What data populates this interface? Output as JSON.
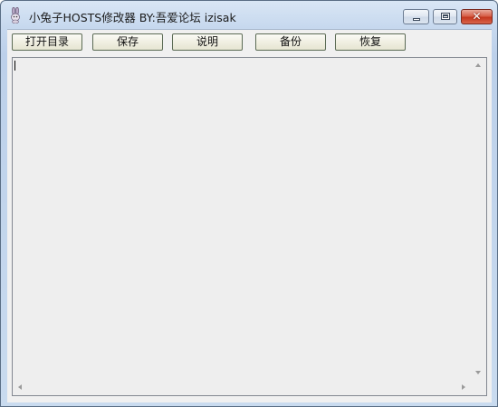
{
  "window": {
    "title": "小兔子HOSTS修改器 BY:吾爱论坛 izisak",
    "icon": "rabbit-icon"
  },
  "caption_buttons": {
    "minimize_icon": "minimize-icon",
    "maximize_icon": "maximize-icon",
    "close_icon": "close-icon",
    "close_glyph": "✕"
  },
  "toolbar": {
    "open_dir_label": "打开目录",
    "save_label": "保存",
    "help_label": "说明",
    "backup_label": "备份",
    "restore_label": "恢复"
  },
  "editor": {
    "content": ""
  },
  "colors": {
    "title_gradient": "#c6d8ee",
    "close_button": "#c4371f",
    "editor_background": "#eeeeee"
  }
}
